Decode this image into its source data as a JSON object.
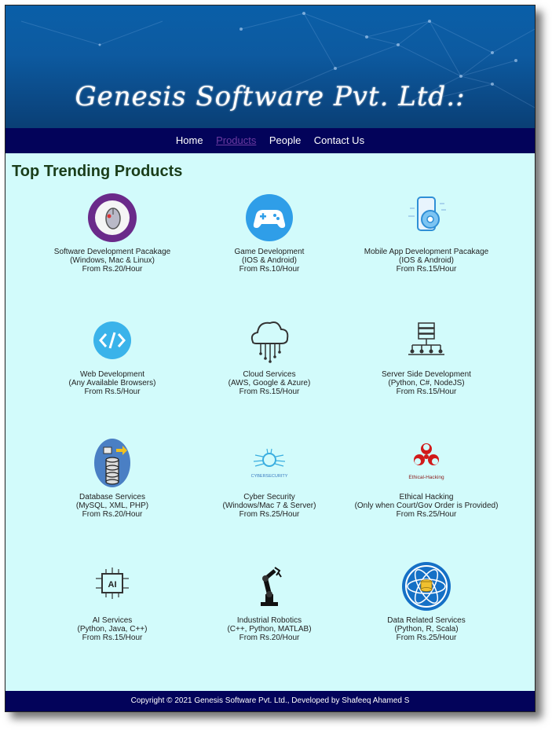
{
  "header": {
    "brand": "Genesis Software Pvt. Ltd.:"
  },
  "nav": {
    "items": [
      "Home",
      "Products",
      "People",
      "Contact Us"
    ],
    "active": "Products"
  },
  "main": {
    "heading": "Top Trending Products",
    "products": [
      {
        "name": "Software Development Pacakage",
        "detail": "(Windows, Mac & Linux)",
        "price": "From Rs.20/Hour",
        "icon": "software-development-badge-icon"
      },
      {
        "name": "Game Development",
        "detail": "(IOS & Android)",
        "price": "From Rs.10/Hour",
        "icon": "gamepad-icon"
      },
      {
        "name": "Mobile App Development Pacakage",
        "detail": "(IOS & Android)",
        "price": "From Rs.15/Hour",
        "icon": "mobile-gear-icon"
      },
      {
        "name": "Web Development",
        "detail": "(Any Available Browsers)",
        "price": "From Rs.5/Hour",
        "icon": "code-icon"
      },
      {
        "name": "Cloud Services",
        "detail": "(AWS, Google & Azure)",
        "price": "From Rs.15/Hour",
        "icon": "cloud-icon"
      },
      {
        "name": "Server Side Development",
        "detail": "(Python, C#, NodeJS)",
        "price": "From Rs.15/Hour",
        "icon": "server-network-icon"
      },
      {
        "name": "Database Services",
        "detail": "(MySQL, XML, PHP)",
        "price": "From Rs.20/Hour",
        "icon": "database-icon"
      },
      {
        "name": "Cyber Security",
        "detail": "(Windows/Mac 7 & Server)",
        "price": "From Rs.25/Hour",
        "icon": "cybersecurity-icon",
        "icon_caption": "CYBERSECURITY"
      },
      {
        "name": "Ethical Hacking",
        "detail": "(Only when Court/Gov Order is Provided)",
        "price": "From Rs.25/Hour",
        "icon": "biohazard-icon",
        "icon_caption": "Ethical-Hacking"
      },
      {
        "name": "AI Services",
        "detail": "(Python, Java, C++)",
        "price": "From Rs.15/Hour",
        "icon": "ai-chip-icon",
        "icon_caption": "AI"
      },
      {
        "name": "Industrial Robotics",
        "detail": "(C++, Python, MATLAB)",
        "price": "From Rs.20/Hour",
        "icon": "robot-arm-icon"
      },
      {
        "name": "Data Related Services",
        "detail": "(Python, R, Scala)",
        "price": "From Rs.25/Hour",
        "icon": "data-globe-icon"
      }
    ]
  },
  "footer": {
    "text": "Copyright © 2021 Genesis Software Pvt. Ltd., Developed by Shafeeq Ahamed S"
  },
  "colors": {
    "nav_bg": "#03035a",
    "page_bg": "#d2fbfb",
    "heading": "#1a3d1a",
    "active_link": "#6b3aa0"
  }
}
